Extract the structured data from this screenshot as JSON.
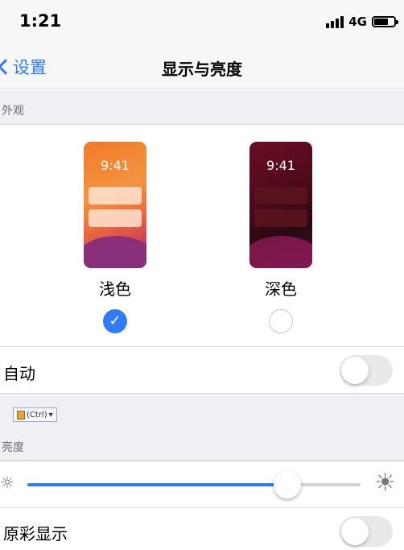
{
  "status_bar": {
    "time": "1:21",
    "network": "4G",
    "battery_level": 0.7
  },
  "nav": {
    "back_label": "设置",
    "title": "显示与亮度"
  },
  "appearance": {
    "section_header": "外观",
    "options": [
      {
        "preview_time": "9:41",
        "label": "浅色",
        "selected": true
      },
      {
        "preview_time": "9:41",
        "label": "深色",
        "selected": false
      }
    ]
  },
  "auto_row": {
    "label": "自动",
    "toggle_on": false
  },
  "paste_chip": {
    "label": "(Ctrl)"
  },
  "brightness": {
    "section_header": "亮度",
    "level": 0.78
  },
  "true_tone_row": {
    "label": "原彩显示",
    "toggle_on": false
  },
  "colors": {
    "accent": "#2f7cf6",
    "background_group": "#efeff4"
  }
}
